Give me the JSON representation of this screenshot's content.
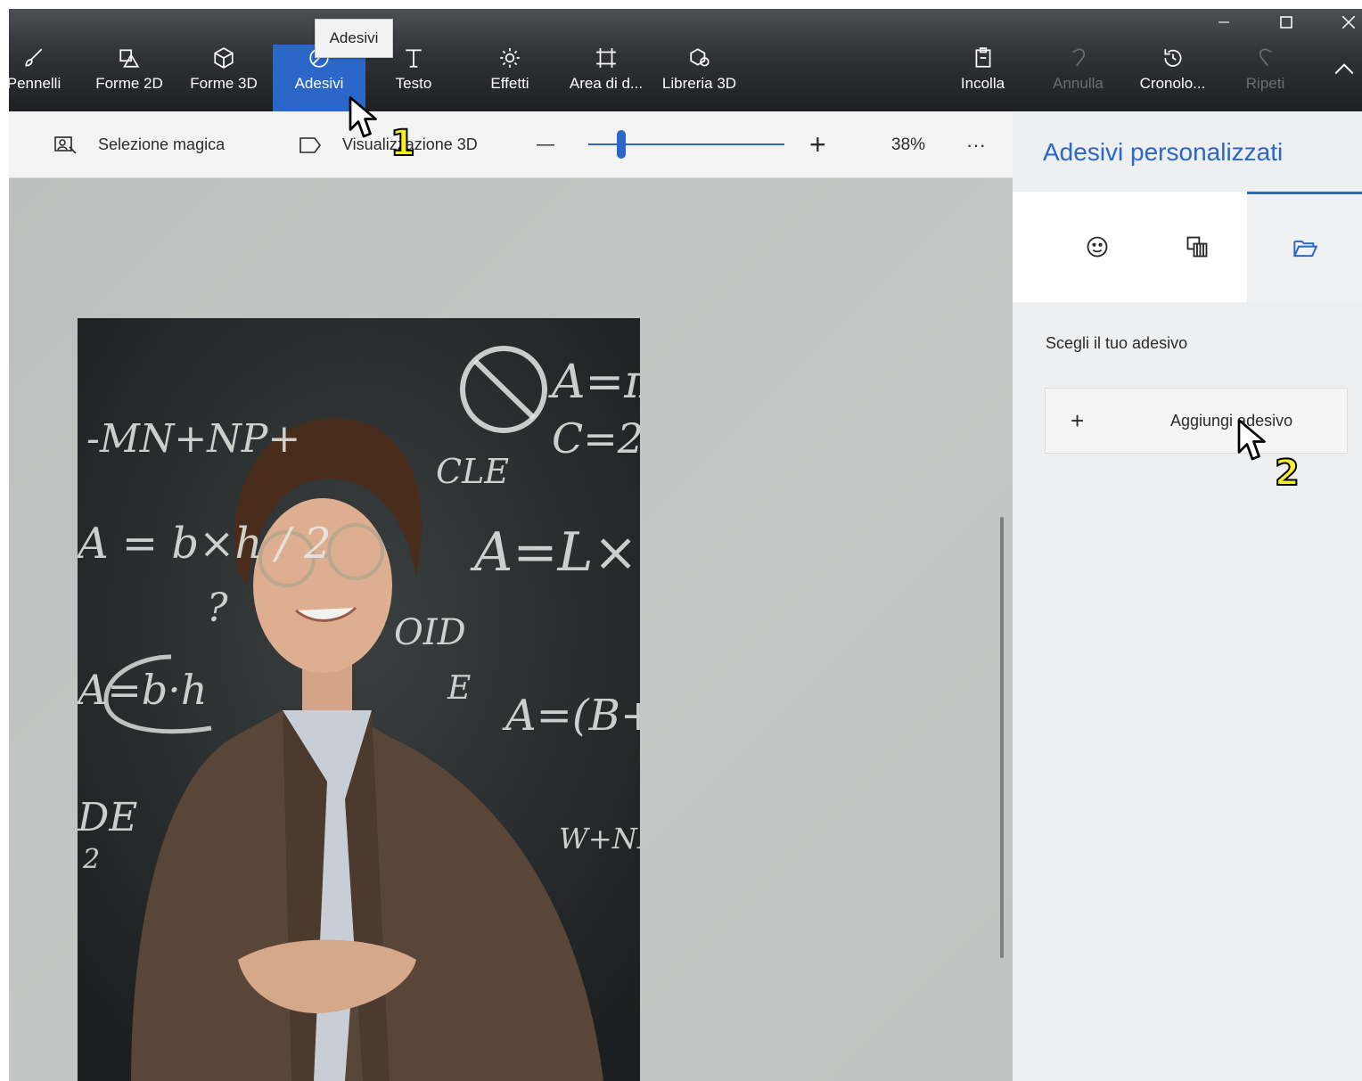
{
  "ribbon": {
    "tools": [
      {
        "id": "pennelli",
        "label": "Pennelli",
        "icon": "brush-icon"
      },
      {
        "id": "forme2d",
        "label": "Forme 2D",
        "icon": "shapes-2d-icon"
      },
      {
        "id": "forme3d",
        "label": "Forme 3D",
        "icon": "cube-icon"
      },
      {
        "id": "adesivi",
        "label": "Adesivi",
        "icon": "sticker-icon",
        "active": true
      },
      {
        "id": "testo",
        "label": "Testo",
        "icon": "text-icon"
      },
      {
        "id": "effetti",
        "label": "Effetti",
        "icon": "sun-icon"
      },
      {
        "id": "area",
        "label": "Area di d...",
        "icon": "crop-icon"
      },
      {
        "id": "libreria3d",
        "label": "Libreria 3D",
        "icon": "library-3d-icon"
      },
      {
        "id": "incolla",
        "label": "Incolla",
        "icon": "paste-icon"
      },
      {
        "id": "annulla",
        "label": "Annulla",
        "icon": "undo-icon",
        "disabled": true
      },
      {
        "id": "cronologia",
        "label": "Cronolo...",
        "icon": "history-icon"
      },
      {
        "id": "ripeti",
        "label": "Ripeti",
        "icon": "redo-icon",
        "disabled": true
      }
    ],
    "tooltip": "Adesivi"
  },
  "toolbar2": {
    "magic_select": "Selezione magica",
    "view_3d": "Visualizzazione 3D",
    "zoom_minus": "—",
    "zoom_plus": "+",
    "zoom": "38%",
    "more": "···",
    "zoom_level": 0.17
  },
  "panel": {
    "title": "Adesivi personalizzati",
    "choose_label": "Scegli il tuo adesivo",
    "add_plus": "+",
    "add_label": "Aggiungi adesivo"
  },
  "chalkboard": {
    "formulas": [
      "A=π",
      "C=2",
      "-MN+NP+",
      "CLE",
      "A = b×h / 2",
      "A=L×",
      "?",
      "OID",
      "A=b·h",
      "A=(B+",
      "E",
      "DE",
      "2",
      "W+NP"
    ]
  },
  "annotations": {
    "step1": "1",
    "step2": "2"
  },
  "colors": {
    "accent": "#2a67c9",
    "ribbon": "#303236",
    "step_marker": "#f7ee2b"
  }
}
